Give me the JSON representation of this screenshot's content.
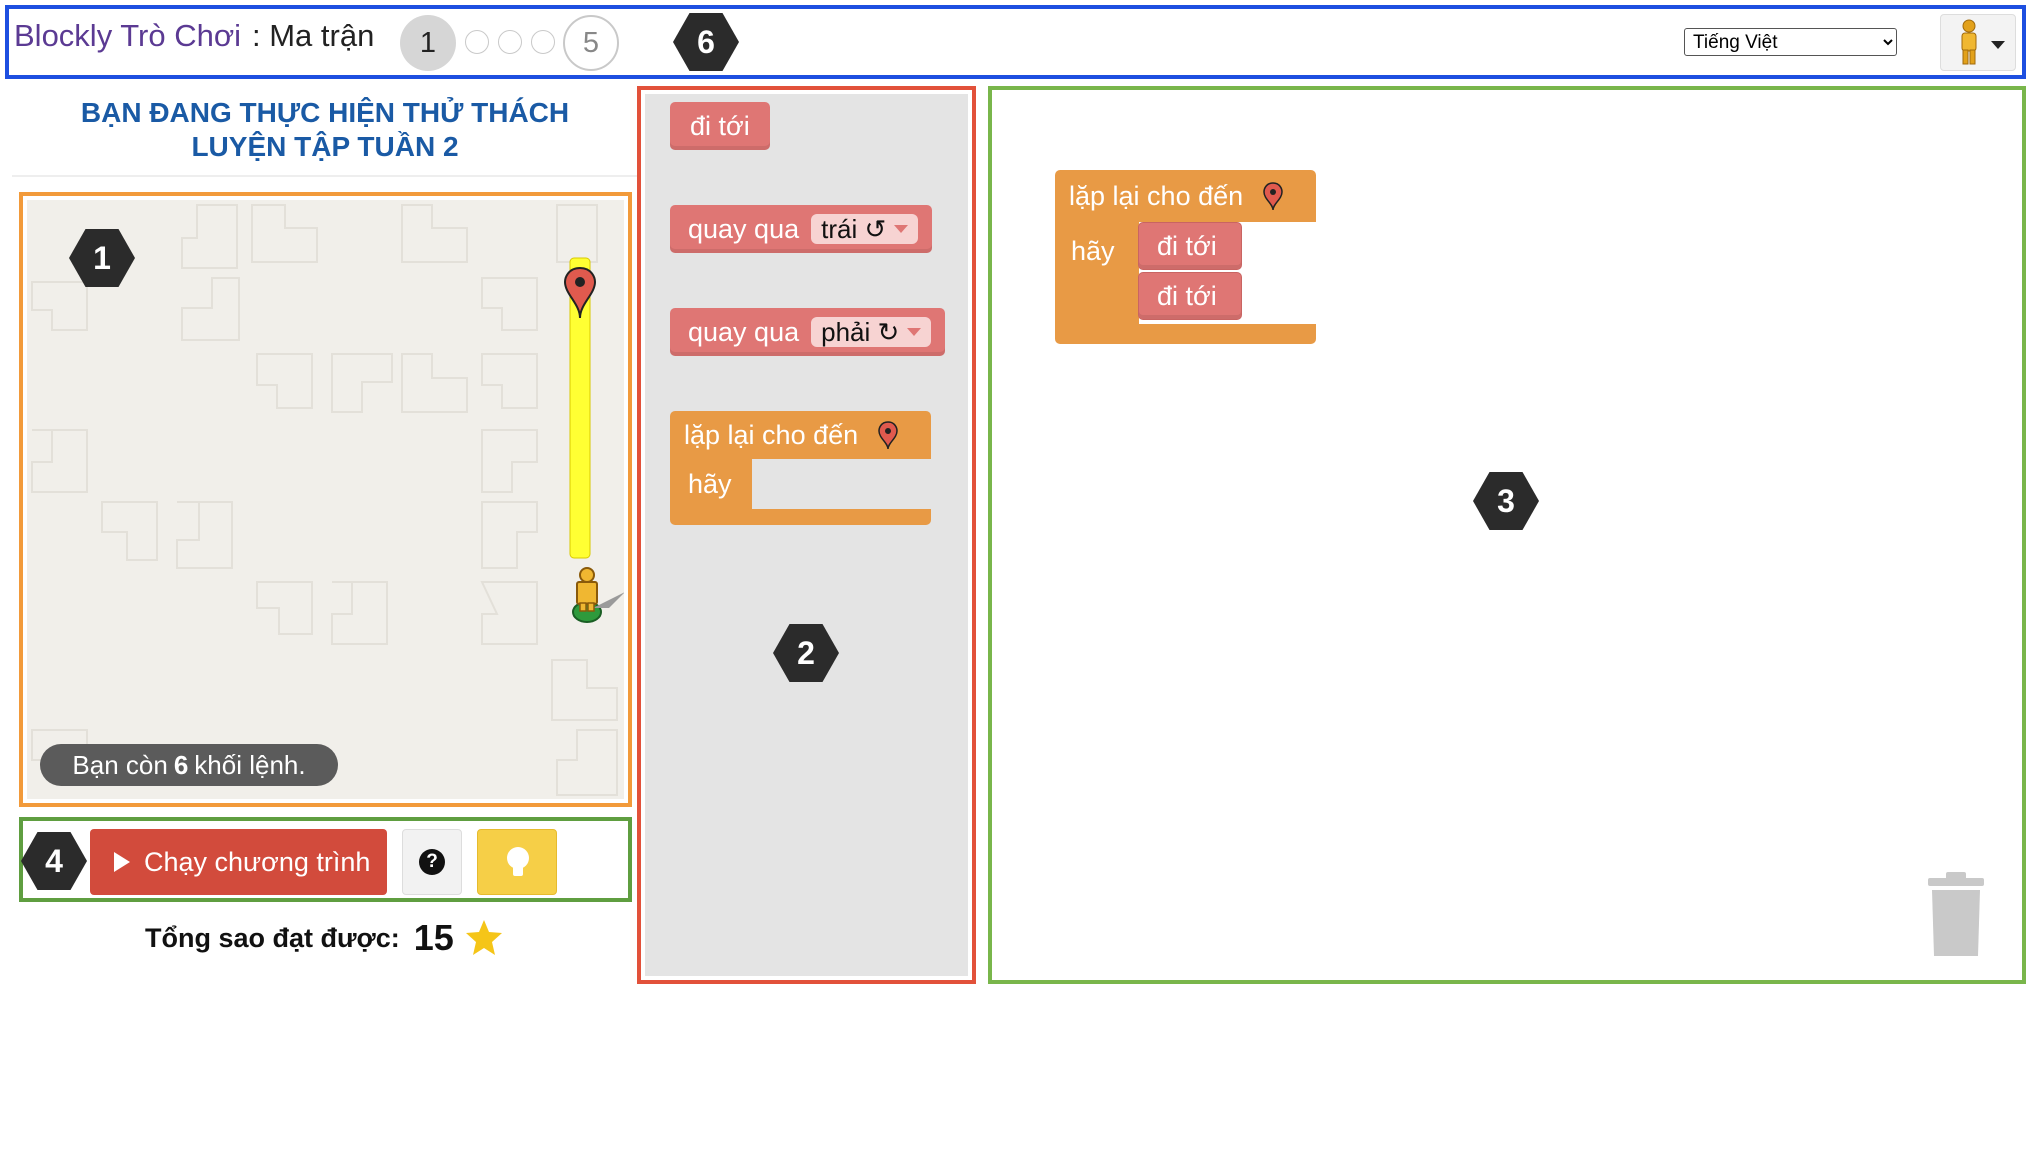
{
  "header": {
    "app_title": "Blockly Trò Chơi",
    "level_title": ": Ma trận",
    "current_level": "1",
    "last_level": "5",
    "language": "Tiếng Việt",
    "marker": "6"
  },
  "left_panel": {
    "challenge_title_line1": "BẠN ĐANG THỰC HIỆN THỬ THÁCH",
    "challenge_title_line2": "LUYỆN TẬP TUẦN 2",
    "maze_marker": "1",
    "blocks_left_prefix": "Bạn còn",
    "blocks_left_count": "6",
    "blocks_left_suffix": "khối lệnh.",
    "controls_marker": "4",
    "run_label": "Chạy chương trình",
    "help_label": "?",
    "stars_label": "Tổng sao đạt được:",
    "stars_count": "15"
  },
  "toolbox": {
    "marker": "2",
    "move_forward": "đi tới",
    "turn_left_label": "quay qua",
    "turn_left_value": "trái ↺",
    "turn_right_label": "quay qua",
    "turn_right_value": "phải ↻",
    "repeat_until": "lặp lại cho đến",
    "do_label": "hãy"
  },
  "workspace": {
    "marker": "3",
    "repeat_until": "lặp lại cho đến",
    "do_label": "hãy",
    "move_1": "đi tới",
    "move_2": "đi tới"
  },
  "colors": {
    "header_border": "#1d4fe0",
    "maze_border": "#f29a3a",
    "toolbox_border": "#e2513a",
    "workspace_border": "#79b64b",
    "move_block": "#df7674",
    "loop_block": "#e89a45",
    "run_button": "#d24b3c",
    "hint_button": "#f6cf47"
  },
  "icons": [
    "marker-pin-icon",
    "pegman-icon",
    "star-icon",
    "lightbulb-icon",
    "help-icon",
    "play-icon",
    "trash-icon",
    "chevron-down-icon"
  ]
}
